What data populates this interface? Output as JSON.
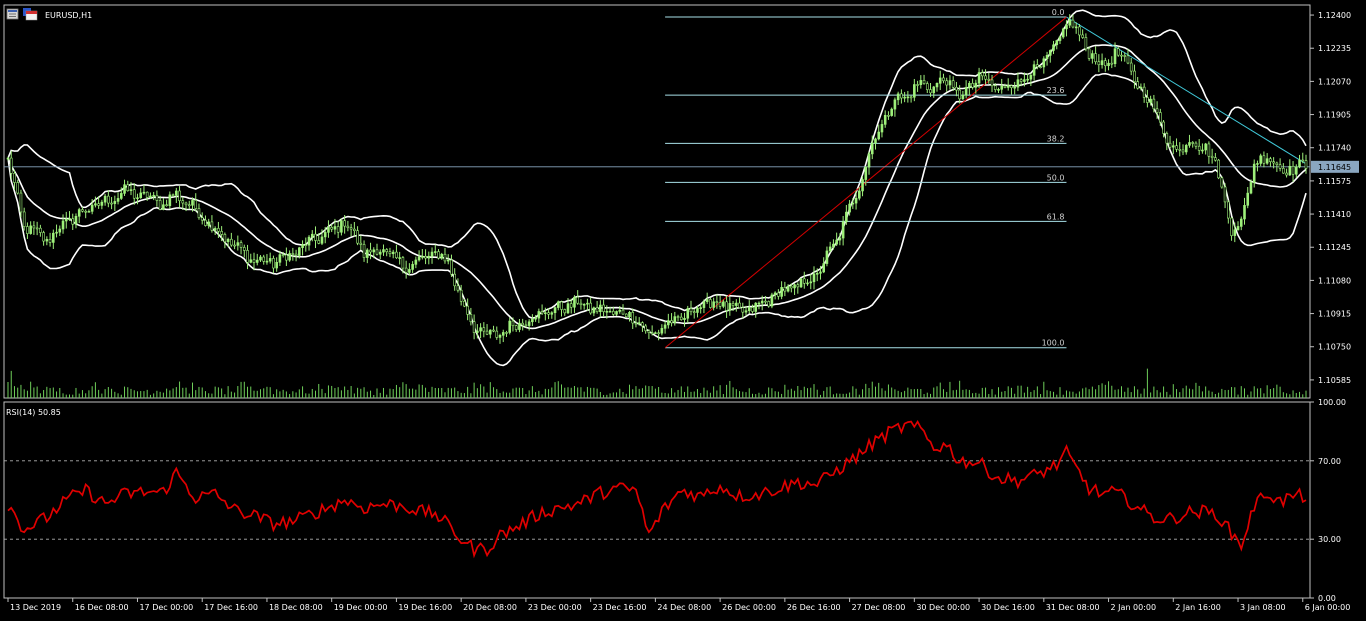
{
  "window": {
    "symbol_title": "EURUSD,H1",
    "rsi_title": "RSI(14) 50.85"
  },
  "colors": {
    "background": "#000000",
    "frame": "#c0c0c0",
    "candle": "#9ef07a",
    "bollinger": "#ffffff",
    "fibo": "#a8e0e8",
    "fibo_trend": "#d00000",
    "trendline": "#40c8d8",
    "bid_line": "#8aa6c0",
    "price_tag": "#8aa6c0",
    "rsi": "#e00000",
    "volume": "#6fcf5a"
  },
  "chart_data": [
    {
      "type": "candlestick",
      "symbol": "EURUSD",
      "timeframe": "H1",
      "ylim": [
        1.10495,
        1.1245
      ],
      "yticks": [
        "1.12400",
        "1.12235",
        "1.12070",
        "1.11905",
        "1.11740",
        "1.11575",
        "1.11410",
        "1.11245",
        "1.11080",
        "1.10915",
        "1.10750",
        "1.10585"
      ],
      "current_price": "1.11645",
      "x_labels": [
        "13 Dec 2019",
        "16 Dec 08:00",
        "17 Dec 00:00",
        "17 Dec 16:00",
        "18 Dec 08:00",
        "19 Dec 00:00",
        "19 Dec 16:00",
        "20 Dec 08:00",
        "23 Dec 00:00",
        "23 Dec 16:00",
        "24 Dec 08:00",
        "26 Dec 00:00",
        "26 Dec 16:00",
        "27 Dec 08:00",
        "30 Dec 00:00",
        "30 Dec 16:00",
        "31 Dec 08:00",
        "2 Jan 00:00",
        "2 Jan 16:00",
        "3 Jan 08:00",
        "6 Jan 00:00"
      ],
      "close_anchors": [
        [
          0,
          1.1168
        ],
        [
          5,
          1.1135
        ],
        [
          12,
          1.1128
        ],
        [
          18,
          1.1137
        ],
        [
          24,
          1.1143
        ],
        [
          30,
          1.1147
        ],
        [
          36,
          1.1152
        ],
        [
          42,
          1.115
        ],
        [
          48,
          1.1146
        ],
        [
          52,
          1.1151
        ],
        [
          58,
          1.1143
        ],
        [
          64,
          1.1134
        ],
        [
          70,
          1.1125
        ],
        [
          76,
          1.1118
        ],
        [
          82,
          1.1117
        ],
        [
          88,
          1.1121
        ],
        [
          94,
          1.1128
        ],
        [
          100,
          1.1132
        ],
        [
          104,
          1.1138
        ],
        [
          110,
          1.1122
        ],
        [
          116,
          1.1123
        ],
        [
          122,
          1.1115
        ],
        [
          128,
          1.1118
        ],
        [
          132,
          1.1122
        ],
        [
          136,
          1.1117
        ],
        [
          140,
          1.1098
        ],
        [
          144,
          1.1085
        ],
        [
          148,
          1.108
        ],
        [
          152,
          1.1082
        ],
        [
          158,
          1.1087
        ],
        [
          164,
          1.1091
        ],
        [
          170,
          1.1094
        ],
        [
          176,
          1.1097
        ],
        [
          182,
          1.1093
        ],
        [
          188,
          1.1092
        ],
        [
          194,
          1.109
        ],
        [
          198,
          1.108
        ],
        [
          202,
          1.1085
        ],
        [
          208,
          1.1089
        ],
        [
          214,
          1.1096
        ],
        [
          220,
          1.1097
        ],
        [
          226,
          1.1092
        ],
        [
          232,
          1.1095
        ],
        [
          238,
          1.1102
        ],
        [
          244,
          1.1105
        ],
        [
          250,
          1.1111
        ],
        [
          256,
          1.1128
        ],
        [
          262,
          1.1151
        ],
        [
          268,
          1.118
        ],
        [
          274,
          1.1198
        ],
        [
          278,
          1.12
        ],
        [
          282,
          1.1206
        ],
        [
          286,
          1.1204
        ],
        [
          290,
          1.1208
        ],
        [
          294,
          1.1199
        ],
        [
          300,
          1.1209
        ],
        [
          306,
          1.1203
        ],
        [
          312,
          1.1207
        ],
        [
          318,
          1.1213
        ],
        [
          324,
          1.1224
        ],
        [
          327,
          1.1238
        ],
        [
          330,
          1.1232
        ],
        [
          334,
          1.1222
        ],
        [
          338,
          1.1214
        ],
        [
          342,
          1.1221
        ],
        [
          346,
          1.1215
        ],
        [
          350,
          1.1202
        ],
        [
          354,
          1.1195
        ],
        [
          358,
          1.1177
        ],
        [
          362,
          1.1173
        ],
        [
          366,
          1.1178
        ],
        [
          370,
          1.1174
        ],
        [
          374,
          1.1162
        ],
        [
          378,
          1.1132
        ],
        [
          381,
          1.1138
        ],
        [
          385,
          1.1165
        ],
        [
          389,
          1.1171
        ],
        [
          393,
          1.1163
        ],
        [
          397,
          1.1164
        ],
        [
          401,
          1.1165
        ]
      ],
      "bars": 402,
      "fibonacci": {
        "high": 1.1239,
        "low": 1.10745,
        "levels": [
          {
            "label": "0.0",
            "ratio": 0
          },
          {
            "label": "23.6",
            "ratio": 0.236
          },
          {
            "label": "38.2",
            "ratio": 0.382
          },
          {
            "label": "50.0",
            "ratio": 0.5
          },
          {
            "label": "61.8",
            "ratio": 0.618
          },
          {
            "label": "100.0",
            "ratio": 1
          }
        ]
      },
      "bollinger_bands": {
        "period": 20,
        "deviations": 2
      }
    },
    {
      "type": "line",
      "name": "RSI(14)",
      "value": 50.85,
      "ylim": [
        0,
        100
      ],
      "yticks": [
        "100.00",
        "70.00",
        "30.00",
        "0.00"
      ],
      "levels": [
        70,
        30
      ],
      "x_labels_shared": true,
      "anchors": [
        [
          0,
          48
        ],
        [
          5,
          35
        ],
        [
          12,
          41
        ],
        [
          18,
          50
        ],
        [
          24,
          55
        ],
        [
          30,
          48
        ],
        [
          36,
          53
        ],
        [
          42,
          54
        ],
        [
          48,
          54
        ],
        [
          52,
          64
        ],
        [
          58,
          51
        ],
        [
          64,
          53
        ],
        [
          70,
          45
        ],
        [
          76,
          42
        ],
        [
          82,
          38
        ],
        [
          88,
          39
        ],
        [
          94,
          43
        ],
        [
          100,
          47
        ],
        [
          104,
          50
        ],
        [
          110,
          46
        ],
        [
          116,
          48
        ],
        [
          122,
          47
        ],
        [
          128,
          44
        ],
        [
          132,
          43
        ],
        [
          136,
          37
        ],
        [
          140,
          30
        ],
        [
          144,
          25
        ],
        [
          148,
          25
        ],
        [
          152,
          32
        ],
        [
          158,
          37
        ],
        [
          164,
          43
        ],
        [
          170,
          46
        ],
        [
          176,
          48
        ],
        [
          182,
          53
        ],
        [
          188,
          56
        ],
        [
          194,
          55
        ],
        [
          198,
          32
        ],
        [
          202,
          44
        ],
        [
          208,
          55
        ],
        [
          214,
          52
        ],
        [
          220,
          57
        ],
        [
          226,
          52
        ],
        [
          232,
          53
        ],
        [
          238,
          56
        ],
        [
          244,
          59
        ],
        [
          250,
          58
        ],
        [
          256,
          65
        ],
        [
          262,
          72
        ],
        [
          268,
          80
        ],
        [
          274,
          86
        ],
        [
          278,
          88
        ],
        [
          282,
          86
        ],
        [
          286,
          77
        ],
        [
          290,
          78
        ],
        [
          294,
          70
        ],
        [
          300,
          69
        ],
        [
          306,
          61
        ],
        [
          312,
          60
        ],
        [
          318,
          63
        ],
        [
          324,
          68
        ],
        [
          327,
          74
        ],
        [
          330,
          66
        ],
        [
          334,
          56
        ],
        [
          338,
          53
        ],
        [
          342,
          54
        ],
        [
          346,
          50
        ],
        [
          350,
          45
        ],
        [
          354,
          41
        ],
        [
          358,
          40
        ],
        [
          362,
          42
        ],
        [
          366,
          44
        ],
        [
          370,
          44
        ],
        [
          374,
          42
        ],
        [
          378,
          33
        ],
        [
          381,
          27
        ],
        [
          385,
          47
        ],
        [
          389,
          54
        ],
        [
          393,
          49
        ],
        [
          397,
          52
        ],
        [
          401,
          52
        ]
      ]
    }
  ]
}
